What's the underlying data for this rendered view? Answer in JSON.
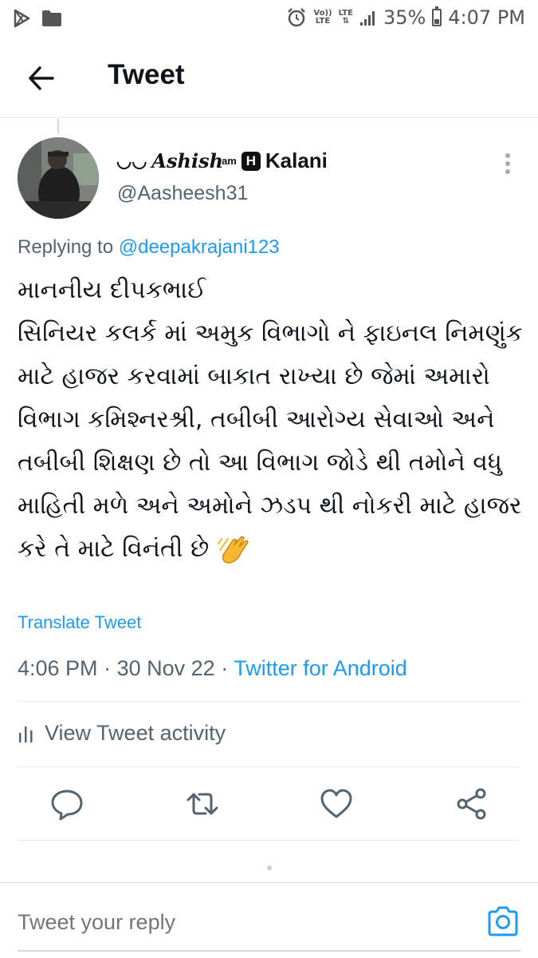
{
  "status_bar": {
    "network_top": "Vo))",
    "network_bottom": "LTE",
    "lte_label": "LTE",
    "battery": "35%",
    "time": "4:07 PM",
    "icons": [
      "play-icon",
      "folder-icon",
      "alarm-icon",
      "signal-icon",
      "battery-icon"
    ]
  },
  "header": {
    "title": "Tweet"
  },
  "tweet": {
    "display_name_logo": "Ashish",
    "display_name_superscript": "am",
    "display_name_badge": "H",
    "display_name_last": "Kalani",
    "handle": "@Aasheesh31",
    "replying_prefix": "Replying to",
    "replying_to": "@deepakrajani123",
    "body": "માનનીય દીપકભાઈ\nસિનિયર કલર્ક માં અમુક વિભાગો ને ફાઇનલ નિમણુંક માટે હાજર કરવામાં બાકાત રાખ્યા છે જેમાં અમારો વિભાગ કમિશ્નરશ્રી, તબીબી આરોગ્ય સેવાઓ અને તબીબી શિક્ષણ છે તો આ વિભાગ જોડે થી તમોને વધુ માહિતી મળે અને અમોને ઝડપ થી નોકરી માટે હાજર કરે તે માટે વિનંતી છે",
    "translate": "Translate Tweet",
    "time": "4:06 PM",
    "date": "30 Nov 22",
    "source": "Twitter for Android",
    "activity": "View Tweet activity"
  },
  "actions": [
    "reply-icon",
    "retweet-icon",
    "like-icon",
    "share-icon"
  ],
  "reply_bar": {
    "placeholder": "Tweet your reply"
  },
  "colors": {
    "accent": "#1d9bf0",
    "text": "#0f1419",
    "secondary": "#536471",
    "divider": "#e6ecf0"
  }
}
